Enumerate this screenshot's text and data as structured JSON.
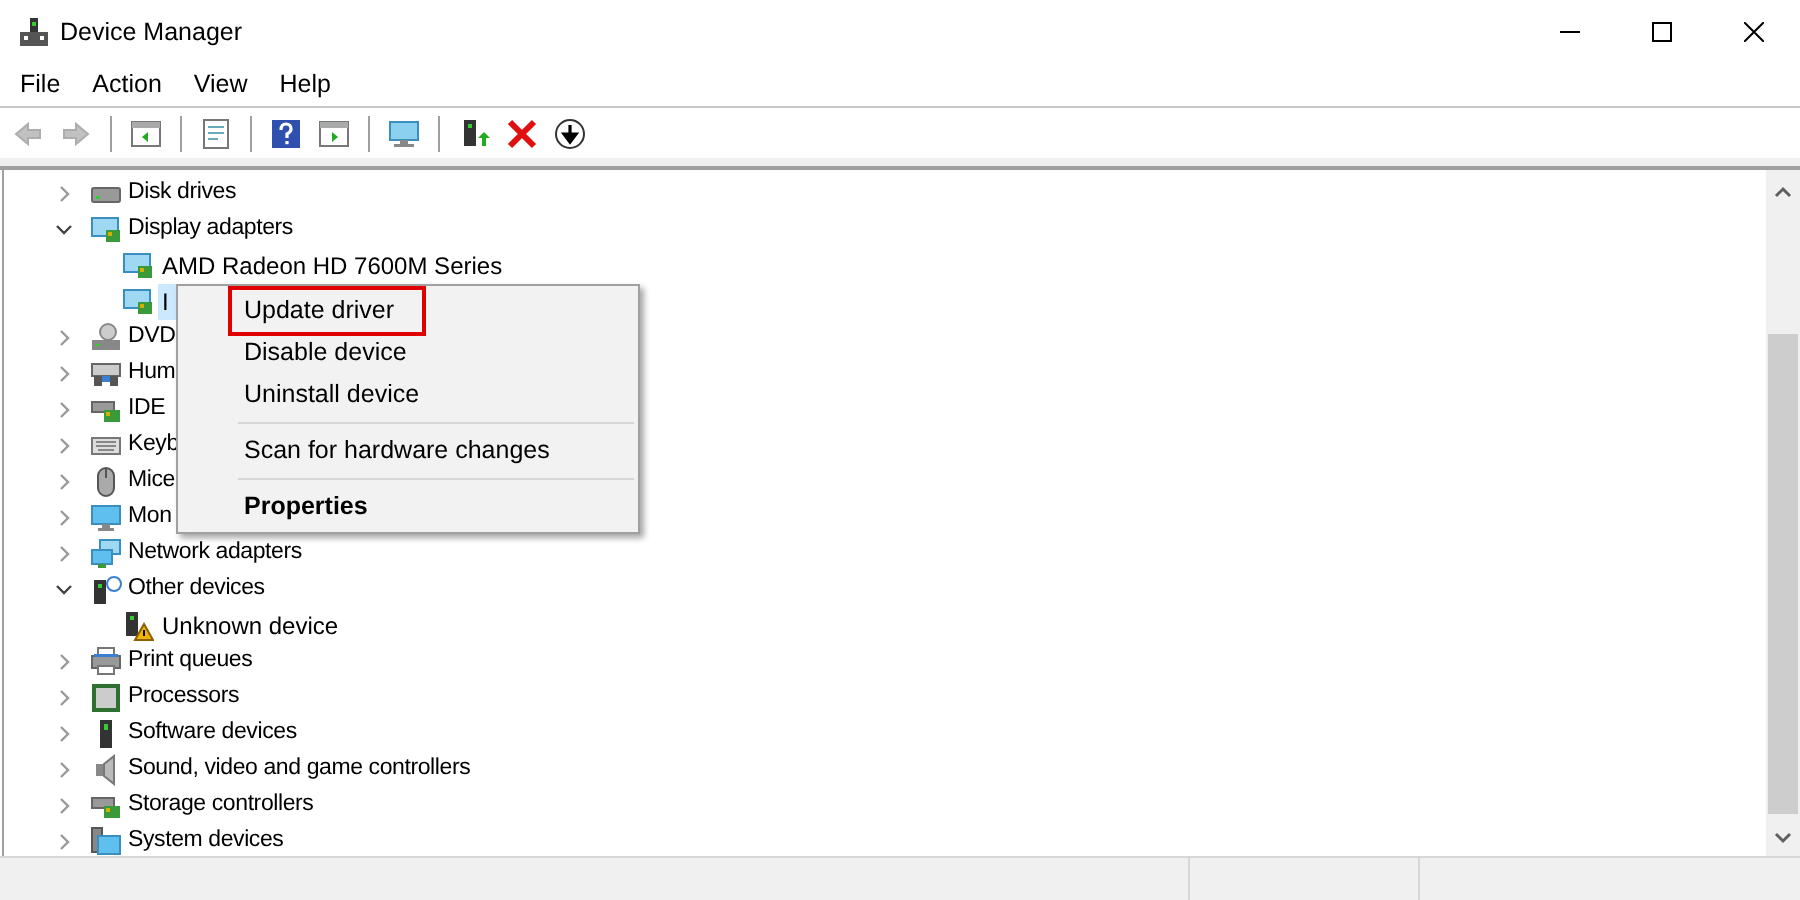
{
  "window": {
    "title": "Device Manager"
  },
  "menu_bar": [
    "File",
    "Action",
    "View",
    "Help"
  ],
  "toolbar": [
    {
      "kind": "back",
      "disabled": true
    },
    {
      "kind": "forward",
      "disabled": true
    },
    {
      "kind": "sep"
    },
    {
      "kind": "tree",
      "disabled": false
    },
    {
      "kind": "sep"
    },
    {
      "kind": "properties",
      "disabled": false
    },
    {
      "kind": "sep"
    },
    {
      "kind": "help",
      "disabled": false
    },
    {
      "kind": "action",
      "disabled": false
    },
    {
      "kind": "sep"
    },
    {
      "kind": "scan",
      "disabled": false
    },
    {
      "kind": "sep"
    },
    {
      "kind": "update",
      "disabled": false
    },
    {
      "kind": "remove",
      "disabled": false
    },
    {
      "kind": "download",
      "disabled": false
    }
  ],
  "tree": [
    {
      "label": "Disk drives",
      "kind": "disk",
      "expanded": false
    },
    {
      "label": "Display adapters",
      "kind": "display",
      "expanded": true,
      "children": [
        {
          "label": "AMD Radeon HD 7600M Series",
          "kind": "display",
          "selected": false
        },
        {
          "label": "I",
          "kind": "display",
          "selected": true
        }
      ]
    },
    {
      "label": "DVD",
      "kind": "dvd",
      "expanded": false
    },
    {
      "label": "Hum",
      "kind": "hid",
      "expanded": false
    },
    {
      "label": "IDE",
      "kind": "ide",
      "expanded": false
    },
    {
      "label": "Keyb",
      "kind": "keyboard",
      "expanded": false
    },
    {
      "label": "Mice",
      "kind": "mouse",
      "expanded": false
    },
    {
      "label": "Mon",
      "kind": "monitor",
      "expanded": false
    },
    {
      "label": "Network adapters",
      "kind": "network",
      "expanded": false
    },
    {
      "label": "Other devices",
      "kind": "other",
      "expanded": true,
      "children": [
        {
          "label": "Unknown device",
          "kind": "unknown",
          "selected": false
        }
      ]
    },
    {
      "label": "Print queues",
      "kind": "printer",
      "expanded": false
    },
    {
      "label": "Processors",
      "kind": "cpu",
      "expanded": false
    },
    {
      "label": "Software devices",
      "kind": "software",
      "expanded": false
    },
    {
      "label": "Sound, video and game controllers",
      "kind": "sound",
      "expanded": false
    },
    {
      "label": "Storage controllers",
      "kind": "ide",
      "expanded": false
    },
    {
      "label": "System devices",
      "kind": "system",
      "expanded": false
    }
  ],
  "context_menu": [
    {
      "label": "Update driver",
      "kind": "item",
      "bold": false,
      "highlighted": true
    },
    {
      "label": "Disable device",
      "kind": "item",
      "bold": false,
      "highlighted": false
    },
    {
      "label": "Uninstall device",
      "kind": "item",
      "bold": false,
      "highlighted": false
    },
    {
      "kind": "separator"
    },
    {
      "label": "Scan for hardware changes",
      "kind": "item",
      "bold": false,
      "highlighted": false
    },
    {
      "kind": "separator"
    },
    {
      "label": "Properties",
      "kind": "item",
      "bold": true,
      "highlighted": false
    }
  ]
}
